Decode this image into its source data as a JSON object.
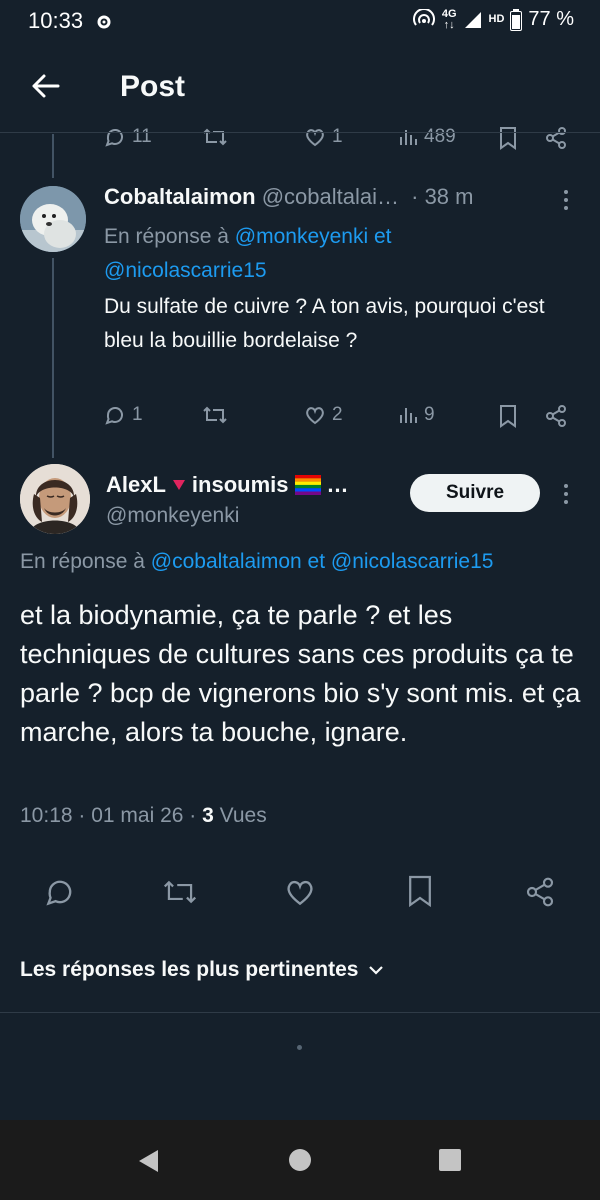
{
  "status_bar": {
    "time": "10:33",
    "network": "4G",
    "hd": "HD",
    "battery": "77 %"
  },
  "header": {
    "title": "Post"
  },
  "prev_actions": {
    "replies": "11",
    "likes": "1",
    "views": "489"
  },
  "reply": {
    "display_name": "Cobaltalaimon",
    "handle": "@cobaltalai…",
    "time": "· 38 m",
    "in_reply_prefix": "En réponse à",
    "mention1": "@monkeyenki",
    "and": "et",
    "mention2": "@nicolascarrie15",
    "text": "Du sulfate de cuivre ? A ton avis, pourquoi c'est bleu la bouillie bordelaise ?",
    "replies": "1",
    "likes": "2",
    "views": "9"
  },
  "main_post": {
    "display_name_1": "AlexL",
    "display_name_2": "insoumis",
    "ellipsis": "…",
    "handle": "@monkeyenki",
    "follow_label": "Suivre",
    "in_reply_prefix": "En réponse à",
    "mention1": "@cobaltalaimon",
    "and": "et",
    "mention2": "@nicolascarrie15",
    "text": "et la biodynamie, ça te parle ? et les techniques de cultures sans ces produits ça te parle ? bcp de vignerons bio s'y sont mis. et ça marche, alors ta bouche, ignare.",
    "time": "10:18 · 01 mai 26 ·",
    "views_count": "3",
    "views_label": "Vues"
  },
  "sort": {
    "label": "Les réponses les plus pertinentes"
  },
  "colors": {
    "background": "#15202b",
    "link": "#1d9bf0",
    "muted": "#8b98a5"
  }
}
